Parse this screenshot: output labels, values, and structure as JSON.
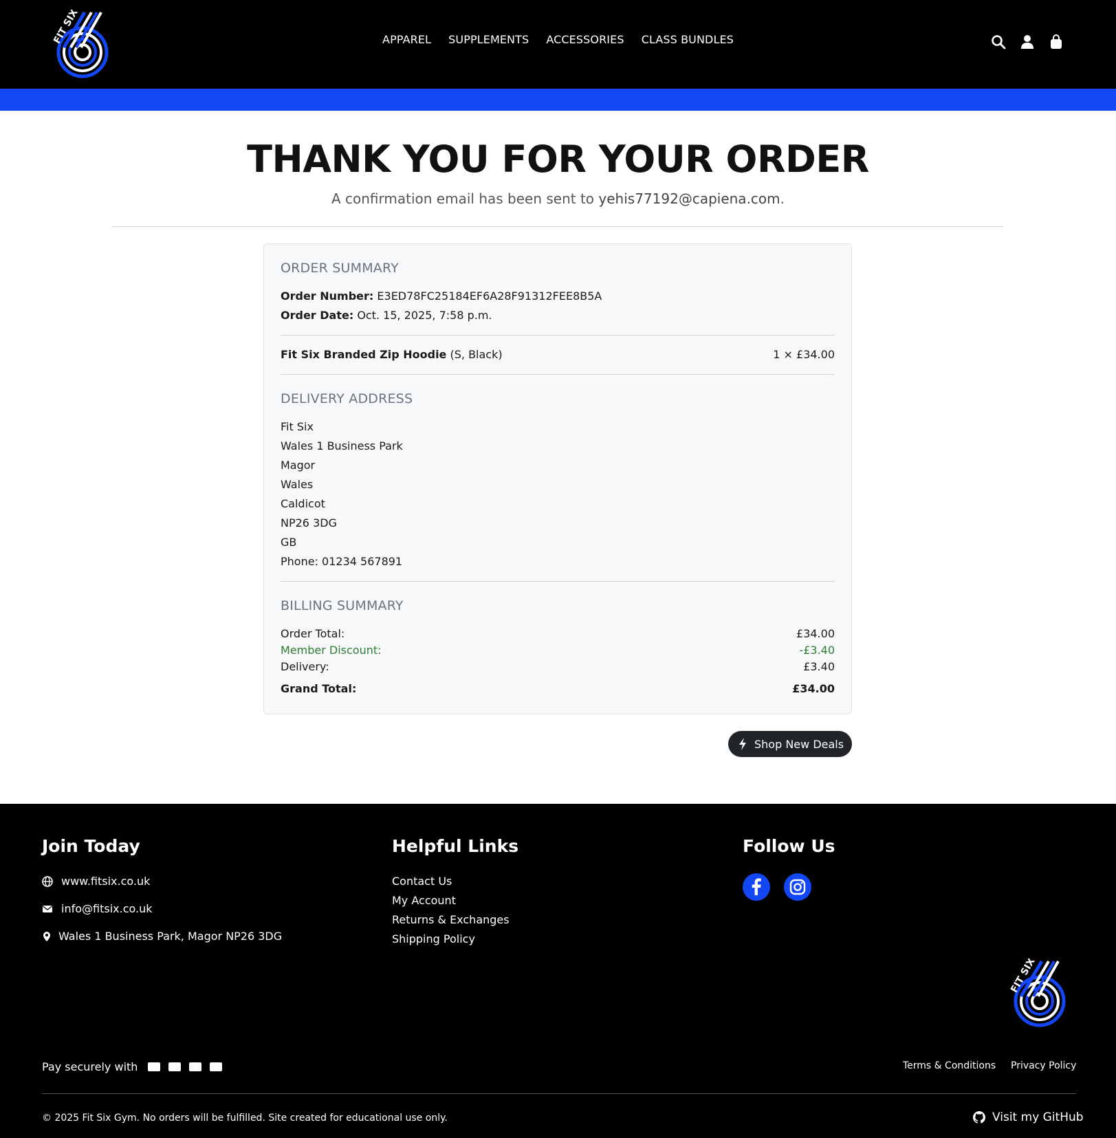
{
  "header": {
    "logo_text": "FIT SIX",
    "nav": [
      "APPAREL",
      "SUPPLEMENTS",
      "ACCESSORIES",
      "CLASS BUNDLES"
    ],
    "icons": [
      "search-icon",
      "user-icon",
      "bag-icon"
    ]
  },
  "colors": {
    "brand_blue": "#1346f5",
    "black": "#000000",
    "discount_green": "#2e7d32"
  },
  "hero": {
    "title": "THANK YOU FOR YOUR ORDER",
    "subtitle_prefix": "A confirmation email has been sent to ",
    "email": "yehis77192@capiena.com",
    "subtitle_suffix": "."
  },
  "summary": {
    "heading": "ORDER SUMMARY",
    "order_number_label": "Order Number:",
    "order_number": "E3ED78FC25184EF6A28F91312FEE8B5A",
    "order_date_label": "Order Date:",
    "order_date": "Oct. 15, 2025, 7:58 p.m.",
    "item_name": "Fit Six Branded Zip Hoodie",
    "item_variant": "(S, Black)",
    "item_qty_price": "1 × £34.00"
  },
  "delivery": {
    "heading": "DELIVERY ADDRESS",
    "lines": [
      "Fit Six",
      "Wales 1 Business Park",
      "Magor",
      "Wales",
      "Caldicot",
      "NP26 3DG",
      "GB",
      "Phone: 01234 567891"
    ]
  },
  "billing": {
    "heading": "BILLING SUMMARY",
    "order_total_label": "Order Total:",
    "order_total": "£34.00",
    "discount_label": "Member Discount:",
    "discount": "-£3.40",
    "delivery_label": "Delivery:",
    "delivery": "£3.40",
    "grand_total_label": "Grand Total:",
    "grand_total": "£34.00"
  },
  "cta": {
    "label": "Shop New Deals"
  },
  "footer": {
    "join_heading": "Join Today",
    "website": "www.fitsix.co.uk",
    "email": "info@fitsix.co.uk",
    "address": "Wales 1 Business Park, Magor NP26 3DG",
    "links_heading": "Helpful Links",
    "links": [
      "Contact Us",
      "My Account",
      "Returns & Exchanges",
      "Shipping Policy"
    ],
    "follow_heading": "Follow Us",
    "social": [
      "facebook-icon",
      "instagram-icon"
    ],
    "pay_label": "Pay securely with",
    "card_icons": [
      "visa-icon",
      "mastercard-icon",
      "amex-icon",
      "discover-icon"
    ],
    "terms": "Terms & Conditions",
    "privacy": "Privacy Policy",
    "copyright": "© 2025 Fit Six Gym. No orders will be fulfilled. Site created for educational use only.",
    "github": "Visit my GitHub"
  }
}
